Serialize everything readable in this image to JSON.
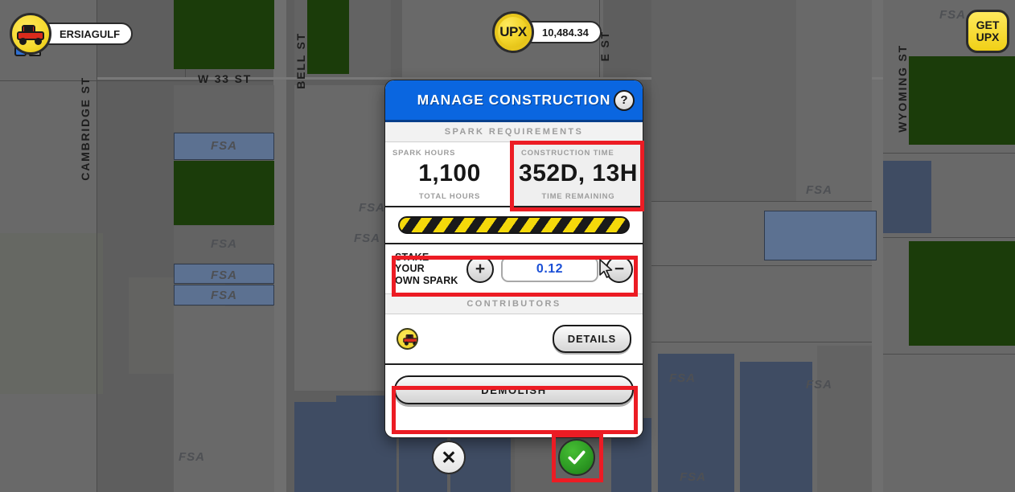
{
  "hud": {
    "player": {
      "avatar_icon": "car-avatar-icon",
      "name": "ERSIAGULF"
    },
    "currency": {
      "coin_label": "UPX",
      "balance": "10,484.34"
    },
    "get_upx": {
      "line1": "GET",
      "line2": "UPX"
    }
  },
  "map": {
    "streets": [
      {
        "name": "CAMBRIDGE ST"
      },
      {
        "name": "W 33 ST"
      },
      {
        "name": "BELL ST"
      },
      {
        "name": "E ST"
      },
      {
        "name": "WYOMING ST"
      }
    ],
    "parcel_label": "FSA"
  },
  "modal": {
    "title": "MANAGE CONSTRUCTION",
    "help_icon": "question-mark-icon",
    "sections": {
      "spark_requirements": "SPARK REQUIREMENTS",
      "contributors": "CONTRIBUTORS"
    },
    "stats": [
      {
        "caption_top": "SPARK HOURS",
        "value": "1,100",
        "caption_bottom": "TOTAL HOURS"
      },
      {
        "caption_top": "CONSTRUCTION TIME",
        "value": "352D, 13H",
        "caption_bottom": "TIME REMAINING"
      }
    ],
    "stake": {
      "label_line1": "STAKE YOUR",
      "label_line2": "OWN SPARK",
      "increment": "+",
      "decrement": "−",
      "value": "0.12"
    },
    "contributor": {
      "avatar_icon": "car-avatar-icon",
      "details_label": "DETAILS"
    },
    "demolish_label": "DEMOLISH",
    "actions": {
      "close_label": "✕",
      "confirm_icon": "checkmark-icon"
    }
  },
  "colors": {
    "header_blue": "#0a66e0",
    "highlight_red": "#ec1c24",
    "confirm_green": "#2e9c24",
    "stake_value_blue": "#1a4fd6",
    "coin_yellow": "#f2d42a"
  }
}
